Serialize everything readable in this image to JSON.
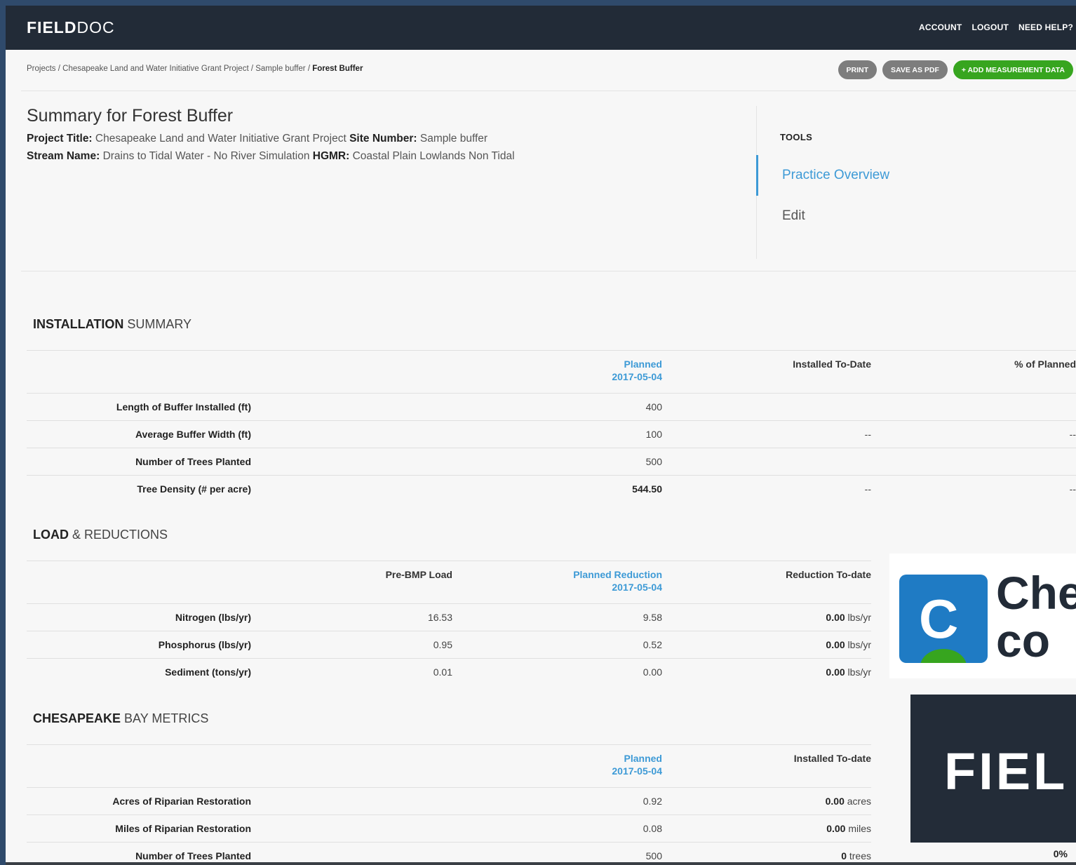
{
  "header": {
    "logo_bold": "FIELD",
    "logo_light": "DOC",
    "nav": [
      "ACCOUNT",
      "LOGOUT",
      "NEED HELP?"
    ]
  },
  "breadcrumb": {
    "items": [
      "Projects",
      "Chesapeake Land and Water Initiative Grant Project",
      "Sample buffer"
    ],
    "current": "Forest Buffer"
  },
  "actions": {
    "print": "PRINT",
    "save_pdf": "SAVE AS PDF",
    "add_measurement": "+ ADD MEASUREMENT DATA"
  },
  "summary": {
    "title": "Summary for Forest Buffer",
    "project_title_label": "Project Title:",
    "project_title": "Chesapeake Land and Water Initiative Grant Project",
    "site_number_label": "Site Number:",
    "site_number": "Sample buffer",
    "stream_name_label": "Stream Name:",
    "stream_name": "Drains to Tidal Water - No River Simulation",
    "hgmr_label": "HGMR:",
    "hgmr": "Coastal Plain Lowlands Non Tidal"
  },
  "tools": {
    "label": "TOOLS",
    "items": [
      "Practice Overview",
      "Edit"
    ]
  },
  "installation": {
    "title_bold": "INSTALLATION",
    "title_light": "SUMMARY",
    "col_planned": "Planned",
    "col_planned_date": "2017-05-04",
    "col_installed": "Installed To-Date",
    "col_pct": "% of Planned",
    "rows": [
      {
        "label": "Length of Buffer Installed (ft)",
        "planned": "400",
        "installed": "",
        "pct": ""
      },
      {
        "label": "Average Buffer Width (ft)",
        "planned": "100",
        "installed": "--",
        "pct": "--"
      },
      {
        "label": "Number of Trees Planted",
        "planned": "500",
        "installed": "",
        "pct": ""
      },
      {
        "label": "Tree Density (# per acre)",
        "planned": "544.50",
        "installed": "--",
        "pct": "--"
      }
    ]
  },
  "loads": {
    "title_bold": "LOAD",
    "title_light": "& REDUCTIONS",
    "col_pre": "Pre-BMP Load",
    "col_planned": "Planned Reduction",
    "col_planned_date": "2017-05-04",
    "col_todate": "Reduction To-date",
    "rows": [
      {
        "label": "Nitrogen (lbs/yr)",
        "pre": "16.53",
        "planned": "9.58",
        "todate_val": "0.00",
        "todate_unit": "lbs/yr"
      },
      {
        "label": "Phosphorus (lbs/yr)",
        "pre": "0.95",
        "planned": "0.52",
        "todate_val": "0.00",
        "todate_unit": "lbs/yr"
      },
      {
        "label": "Sediment (tons/yr)",
        "pre": "0.01",
        "planned": "0.00",
        "todate_val": "0.00",
        "todate_unit": "lbs/yr"
      }
    ]
  },
  "metrics": {
    "title_bold": "CHESAPEAKE",
    "title_light": "BAY METRICS",
    "col_planned": "Planned",
    "col_planned_date": "2017-05-04",
    "col_installed": "Installed To-date",
    "rows": [
      {
        "label": "Acres of Riparian Restoration",
        "planned": "0.92",
        "inst_val": "0.00",
        "inst_unit": "acres"
      },
      {
        "label": "Miles of Riparian Restoration",
        "planned": "0.08",
        "inst_val": "0.00",
        "inst_unit": "miles"
      },
      {
        "label": "Number of Trees Planted",
        "planned": "500",
        "inst_val": "0",
        "inst_unit": "trees"
      }
    ],
    "last_pct": "0%"
  },
  "overlays": {
    "logo_letter": "C",
    "logo_text_1": "Che",
    "logo_text_2": "co",
    "fielddoc_text": "FIEL"
  }
}
